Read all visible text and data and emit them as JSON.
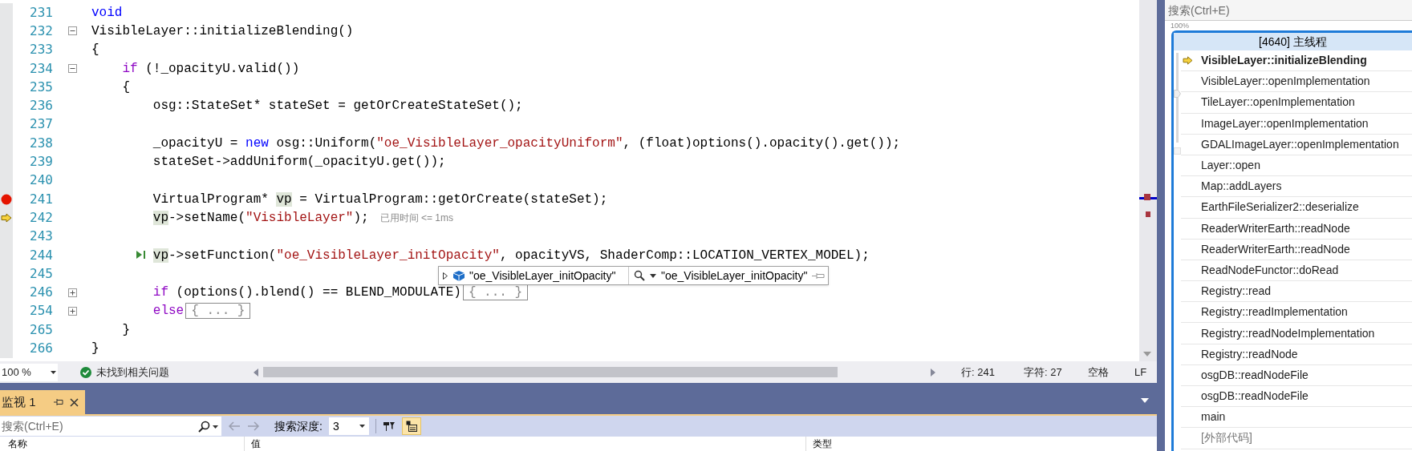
{
  "editor": {
    "lines": [
      {
        "number": "231",
        "breakpoint": false,
        "current": false,
        "tokens": [
          {
            "kind": "kw",
            "text": "void"
          }
        ]
      },
      {
        "number": "232",
        "breakpoint": false,
        "current": false,
        "fold": {
          "expanded": true
        },
        "tokens": [
          {
            "kind": "plain",
            "text": "VisibleLayer::initializeBlending()"
          }
        ]
      },
      {
        "number": "233",
        "breakpoint": false,
        "current": false,
        "tokens": [
          {
            "kind": "plain",
            "text": "{"
          }
        ]
      },
      {
        "number": "234",
        "breakpoint": false,
        "current": false,
        "fold": {
          "expanded": true
        },
        "tokens": [
          {
            "kind": "ctl",
            "text": "    if"
          },
          {
            "kind": "plain",
            "text": " (!_opacityU.valid())"
          }
        ]
      },
      {
        "number": "235",
        "breakpoint": false,
        "current": false,
        "tokens": [
          {
            "kind": "plain",
            "text": "    {"
          }
        ]
      },
      {
        "number": "236",
        "breakpoint": false,
        "current": false,
        "tokens": [
          {
            "kind": "plain",
            "text": "        osg::StateSet* stateSet = getOrCreateStateSet();"
          }
        ]
      },
      {
        "number": "237",
        "breakpoint": false,
        "current": false
      },
      {
        "number": "238",
        "breakpoint": false,
        "current": false,
        "tokens": [
          {
            "kind": "plain",
            "text": "        _opacityU = "
          },
          {
            "kind": "kw",
            "text": "new"
          },
          {
            "kind": "plain",
            "text": " osg::Uniform("
          },
          {
            "kind": "str",
            "text": "\"oe_VisibleLayer_opacityUniform\""
          },
          {
            "kind": "plain",
            "text": ", (float)options().opacity().get());"
          }
        ]
      },
      {
        "number": "239",
        "breakpoint": false,
        "current": false,
        "tokens": [
          {
            "kind": "plain",
            "text": "        stateSet->addUniform(_opacityU.get());"
          }
        ]
      },
      {
        "number": "240",
        "breakpoint": false,
        "current": false
      },
      {
        "number": "241",
        "breakpoint": true,
        "current": false,
        "tokens": [
          {
            "kind": "plain",
            "text": "        VirtualProgram* "
          },
          {
            "kind": "ref",
            "text": "vp"
          },
          {
            "kind": "plain",
            "text": " = VirtualProgram::getOrCreate(stateSet);"
          }
        ]
      },
      {
        "number": "242",
        "breakpoint": false,
        "current": true,
        "hint": "已用时间 <= 1ms",
        "tokens": [
          {
            "kind": "ref",
            "text": "        vp"
          },
          {
            "kind": "plain",
            "text": "->setName("
          },
          {
            "kind": "str",
            "text": "\"VisibleLayer\""
          },
          {
            "kind": "plain",
            "text": ");"
          }
        ]
      },
      {
        "number": "243",
        "breakpoint": false,
        "current": false
      },
      {
        "number": "244",
        "breakpoint": false,
        "current": false,
        "run_to_click": true,
        "tokens": [
          {
            "kind": "ref",
            "text": "        vp"
          },
          {
            "kind": "plain",
            "text": "->setFunction("
          },
          {
            "kind": "str",
            "text": "\"oe_VisibleLayer_initOpacity\""
          },
          {
            "kind": "plain",
            "text": ", opacityVS, ShaderComp::LOCATION_VERTEX_MODEL);"
          }
        ]
      },
      {
        "number": "245",
        "breakpoint": false,
        "current": false
      },
      {
        "number": "246",
        "breakpoint": false,
        "current": false,
        "fold": {
          "expanded": false
        },
        "tokens": [
          {
            "kind": "ctl",
            "text": "        if"
          },
          {
            "kind": "plain",
            "text": " (options().blend() == BLEND_MODULATE)"
          },
          {
            "kind": "collapsed",
            "text": "{ ... }"
          }
        ]
      },
      {
        "number": "254",
        "breakpoint": false,
        "current": false,
        "fold": {
          "expanded": false
        },
        "tokens": [
          {
            "kind": "ctl",
            "text": "        else"
          },
          {
            "kind": "collapsed",
            "text": "{ ... }"
          }
        ]
      },
      {
        "number": "265",
        "breakpoint": false,
        "current": false,
        "tokens": [
          {
            "kind": "plain",
            "text": "    }"
          }
        ]
      },
      {
        "number": "266",
        "breakpoint": false,
        "current": false,
        "tokens": [
          {
            "kind": "plain",
            "text": "}"
          }
        ]
      }
    ],
    "datatip": {
      "expanded": false,
      "name": "\"oe_VisibleLayer_initOpacity\"",
      "value": "\"oe_VisibleLayer_initOpacity\""
    }
  },
  "status_bar": {
    "zoom": "100 %",
    "issues": "未找到相关问题",
    "line": "行: 241",
    "char": "字符: 27",
    "indent": "空格",
    "line_ending": "LF"
  },
  "watch": {
    "tab": {
      "label": "监视 1"
    },
    "search": {
      "placeholder": "搜索(Ctrl+E)"
    },
    "depth_label": "搜索深度:",
    "depth": "3",
    "raw_view_on": true,
    "columns": [
      "名称",
      "值",
      "类型"
    ]
  },
  "parallel_stacks": {
    "search": {
      "placeholder": "搜索(Ctrl+E)"
    },
    "zoom_label": "100%",
    "zoom_slider": {
      "level": 0.55
    },
    "thread": "[4640] 主线程",
    "frames": [
      {
        "name": "VisibleLayer::initializeBlending",
        "current": true,
        "kind": "frame"
      },
      {
        "name": "VisibleLayer::openImplementation",
        "current": false,
        "kind": "frame"
      },
      {
        "name": "TileLayer::openImplementation",
        "current": false,
        "kind": "frame"
      },
      {
        "name": "ImageLayer::openImplementation",
        "current": false,
        "kind": "frame"
      },
      {
        "name": "GDALImageLayer::openImplementation",
        "current": false,
        "kind": "frame"
      },
      {
        "name": "Layer::open",
        "current": false,
        "kind": "frame"
      },
      {
        "name": "Map::addLayers",
        "current": false,
        "kind": "frame"
      },
      {
        "name": "EarthFileSerializer2::deserialize",
        "current": false,
        "kind": "frame"
      },
      {
        "name": "ReaderWriterEarth::readNode",
        "current": false,
        "kind": "frame"
      },
      {
        "name": "ReaderWriterEarth::readNode",
        "current": false,
        "kind": "frame"
      },
      {
        "name": "ReadNodeFunctor::doRead",
        "current": false,
        "kind": "frame"
      },
      {
        "name": "Registry::read",
        "current": false,
        "kind": "frame"
      },
      {
        "name": "Registry::readImplementation",
        "current": false,
        "kind": "frame"
      },
      {
        "name": "Registry::readNodeImplementation",
        "current": false,
        "kind": "frame"
      },
      {
        "name": "Registry::readNode",
        "current": false,
        "kind": "frame"
      },
      {
        "name": "osgDB::readNodeFile",
        "current": false,
        "kind": "frame"
      },
      {
        "name": "osgDB::readNodeFile",
        "current": false,
        "kind": "frame"
      },
      {
        "name": "main",
        "current": false,
        "kind": "frame"
      },
      {
        "name": "[外部代码]",
        "current": false,
        "kind": "external"
      }
    ]
  }
}
